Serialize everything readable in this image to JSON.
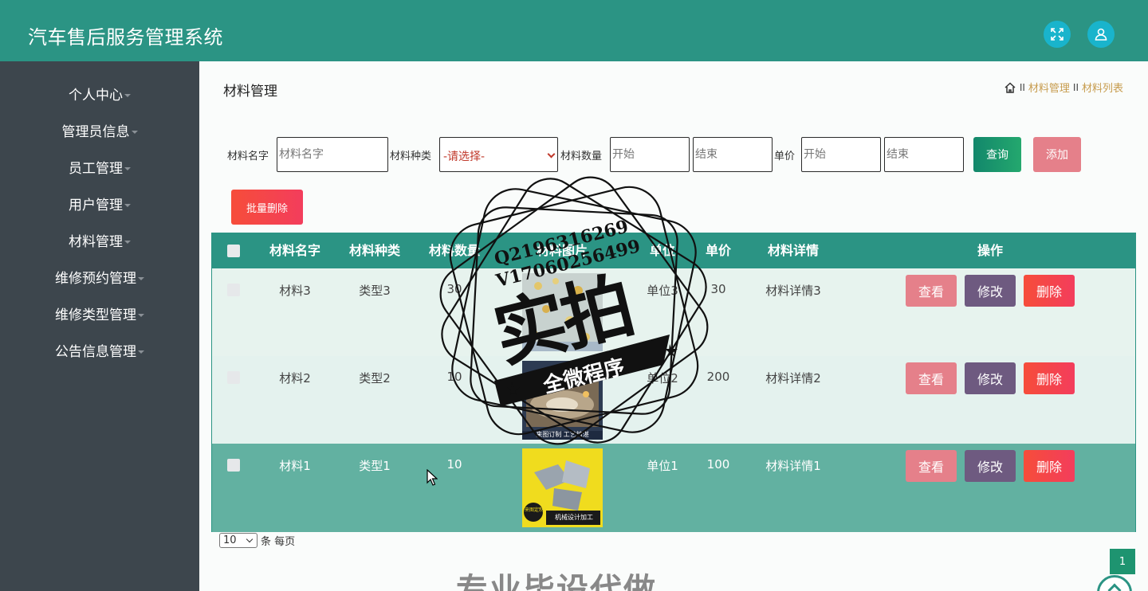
{
  "app": {
    "title": "汽车售后服务管理系统"
  },
  "header": {
    "fullscreen_icon": "expand-icon",
    "user_icon": "user-icon"
  },
  "sidebar": {
    "items": [
      {
        "label": "个人中心"
      },
      {
        "label": "管理员信息"
      },
      {
        "label": "员工管理"
      },
      {
        "label": "用户管理"
      },
      {
        "label": "材料管理"
      },
      {
        "label": "维修预约管理"
      },
      {
        "label": "维修类型管理"
      },
      {
        "label": "公告信息管理"
      }
    ]
  },
  "page": {
    "title": "材料管理",
    "breadcrumb": {
      "sep": "II",
      "items": [
        "材料管理",
        "材料列表"
      ]
    }
  },
  "filters": {
    "name_label": "材料名字",
    "name_placeholder": "材料名字",
    "type_label": "材料种类",
    "type_value": "-请选择-",
    "qty_label": "材料数量",
    "qty_start_placeholder": "开始",
    "qty_end_placeholder": "结束",
    "price_label": "单价",
    "price_start_placeholder": "开始",
    "price_end_placeholder": "结束",
    "query_label": "查询",
    "add_label": "添加",
    "batch_delete_label": "批量删除"
  },
  "table": {
    "columns": [
      "材料名字",
      "材料种类",
      "材料数量",
      "材料图片",
      "单位",
      "单价",
      "材料详情",
      "操作"
    ],
    "rows": [
      {
        "name": "材料3",
        "type": "类型3",
        "qty": "30",
        "unit": "单位3",
        "price": "30",
        "detail": "材料详情3"
      },
      {
        "name": "材料2",
        "type": "类型2",
        "qty": "10",
        "unit": "单位2",
        "price": "200",
        "detail": "材料详情2"
      },
      {
        "name": "材料1",
        "type": "类型1",
        "qty": "10",
        "unit": "单位1",
        "price": "100",
        "detail": "材料详情1"
      }
    ],
    "actions": {
      "view": "查看",
      "edit": "修改",
      "delete": "删除"
    }
  },
  "pagination": {
    "page_size": "10",
    "per_page_label": "条 每页",
    "current_page": "1"
  },
  "watermark": {
    "qq": "Q2196316269",
    "wechat": "V17060256499",
    "main": "实拍",
    "ribbon": "全微程序",
    "bottom": "专业毕设代做"
  },
  "thumb_captions": {
    "row2": "来图订制 工艺精湛",
    "row3_a": "来图定制",
    "row3_b": "机械设计加工"
  },
  "colors": {
    "primary": "#2b9484",
    "sidebar": "#3d464d",
    "danger": "#f64d3a",
    "view": "#e5808a",
    "edit": "#6e5a80"
  }
}
